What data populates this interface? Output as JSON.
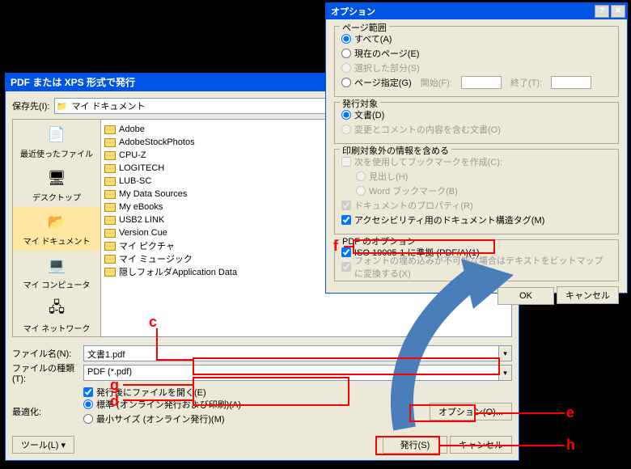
{
  "main": {
    "title": "PDF または XPS 形式で発行",
    "save_to_label": "保存先(I):",
    "location": "マイ ドキュメント",
    "places": [
      {
        "label": "最近使ったファイル",
        "icon": "📄"
      },
      {
        "label": "デスクトップ",
        "icon": "🖥"
      },
      {
        "label": "マイ ドキュメント",
        "icon": "📂",
        "sel": true
      },
      {
        "label": "マイ コンピュータ",
        "icon": "💻"
      },
      {
        "label": "マイ ネットワーク",
        "icon": "🖧"
      }
    ],
    "files": [
      "Adobe",
      "AdobeStockPhotos",
      "CPU-Z",
      "LOGITECH",
      "LUB-SC",
      "My Data Sources",
      "My eBooks",
      "USB2 LINK",
      "Version Cue",
      "マイ ピクチャ",
      "マイ ミュージック",
      "隠しフォルダApplication Data"
    ],
    "filename_label": "ファイル名(N):",
    "filename_value": "文書1.pdf",
    "filetype_label": "ファイルの種類(T):",
    "filetype_value": "PDF (*.pdf)",
    "open_after_label": "発行後にファイルを開く(E)",
    "optimize_label": "最適化:",
    "optimize_standard": "標準 (オンライン発行および印刷)(A)",
    "optimize_min": "最小サイズ (オンライン発行)(M)",
    "options_btn": "オプション(O)...",
    "tool_btn": "ツール(L)",
    "publish_btn": "発行(S)",
    "cancel_btn": "キャンセル"
  },
  "options": {
    "title": "オプション",
    "page_range": {
      "legend": "ページ範囲",
      "all": "すべて(A)",
      "current": "現在のページ(E)",
      "selection": "選択した部分(S)",
      "pages": "ページ指定(G)",
      "from_label": "開始(F):",
      "to_label": "終了(T):"
    },
    "target": {
      "legend": "発行対象",
      "document": "文書(D)",
      "with_markup": "変更とコメントの内容を含む文書(O)"
    },
    "nonprint": {
      "legend": "印刷対象外の情報を含める",
      "bookmarks": "次を使用してブックマークを作成(C):",
      "headings": "見出し(H)",
      "word_bm": "Word ブックマーク(B)",
      "docprops": "ドキュメントのプロパティ(R)",
      "accessibility": "アクセシビリティ用のドキュメント構造タグ(M)"
    },
    "pdf": {
      "legend": "PDF のオプション",
      "iso": "ISO 19005-1 に準拠 (PDF/A)(1)",
      "bitmap": "フォントの埋め込みが不可能な場合はテキストをビットマップに変換する(X)"
    },
    "ok": "OK",
    "cancel": "キャンセル"
  },
  "annotations": {
    "c": "c",
    "d": "d",
    "e": "e",
    "f": "f",
    "g": "g",
    "h": "h"
  }
}
